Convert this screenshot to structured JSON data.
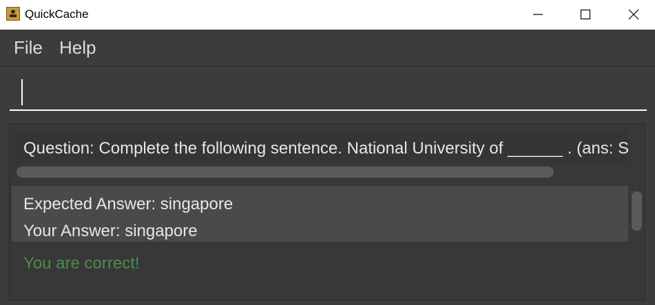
{
  "window": {
    "title": "QuickCache",
    "icon": "app-logo-icon",
    "controls": [
      "minimize-icon",
      "maximize-icon",
      "close-icon"
    ]
  },
  "menu": {
    "file_label": "File",
    "help_label": "Help"
  },
  "command": {
    "value": ""
  },
  "result": {
    "question": "Question: Complete the following sentence. National University of ______ . (ans: Si",
    "expected_answer": "Expected Answer: singapore",
    "your_answer": "Your Answer: singapore",
    "feedback": "You are correct!"
  },
  "colors": {
    "background": "#3c3c3c",
    "text": "#e6e6e6",
    "correct": "#4f8a4f",
    "answer_box": "#4a4a4a"
  }
}
